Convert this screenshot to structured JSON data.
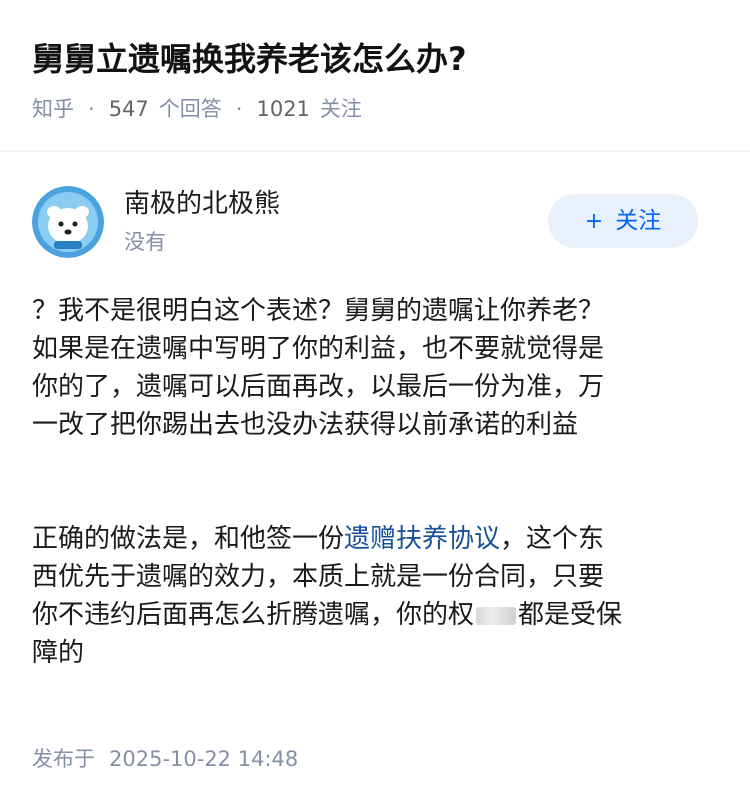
{
  "question": {
    "title": "舅舅立遗嘱换我养老该怎么办?",
    "source": "知乎",
    "answers_count": "547",
    "answers_label": "个回答",
    "followers_count": "1021",
    "followers_label": "关注"
  },
  "author": {
    "name": "南极的北极熊",
    "bio": "没有",
    "follow_plus": "+",
    "follow_label": "关注"
  },
  "answer": {
    "paragraph1": [
      "？我不是很明白这个表述？舅舅的遗嘱让你养老？",
      "如果是在遗嘱中写明了你的利益，也不要就觉得是",
      "你的了，遗嘱可以后面再改，以最后一份为准，万",
      "一改了把你踢出去也没办法获得以前承诺的利益"
    ],
    "paragraph2": {
      "line1_before": "正确的做法是，和他签一份",
      "line1_link": "遗赠扶养协议",
      "line1_after": "，这个东",
      "line2": "西优先于遗嘱的效力，本质上就是一份合同，只要",
      "line3_before": "你不违约后面再怎么折腾遗嘱，你的权",
      "line3_after": "都是受保",
      "line4": "障的"
    }
  },
  "footer": {
    "publish_label": "发布于",
    "publish_time": "2025-10-22 14:48"
  }
}
